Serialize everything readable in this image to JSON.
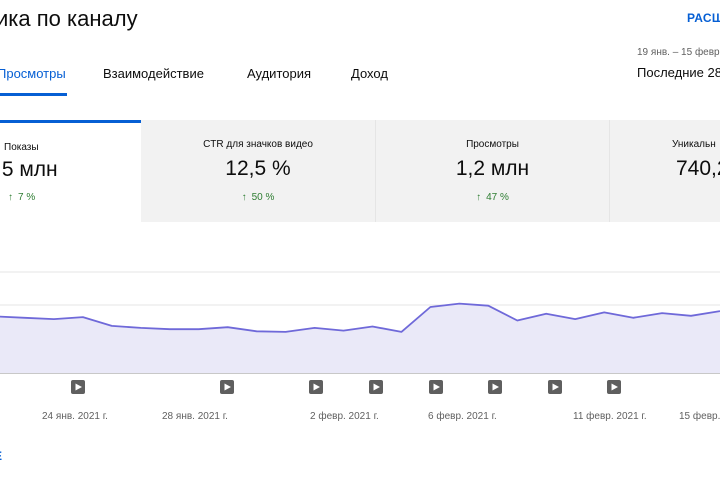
{
  "header": {
    "title": "ика по каналу",
    "advanced_link": "РАСШ"
  },
  "period": {
    "range": "19 янв. – 15 февр.",
    "label": "Последние 28"
  },
  "tabs": [
    {
      "label": "Просмотры",
      "active": true
    },
    {
      "label": "Взаимодействие",
      "active": false
    },
    {
      "label": "Аудитория",
      "active": false
    },
    {
      "label": "Доход",
      "active": false
    }
  ],
  "metrics": [
    {
      "label": "Показы",
      "value": ",5 млн",
      "change": "7 %",
      "trend": "up"
    },
    {
      "label": "CTR для значков видео",
      "value": "12,5 %",
      "change": "50 %",
      "trend": "up"
    },
    {
      "label": "Просмотры",
      "value": "1,2 млн",
      "change": "47 %",
      "trend": "up"
    },
    {
      "label": "Уникальн",
      "value": "740,2",
      "change": "",
      "trend": "up"
    }
  ],
  "colors": {
    "accent": "#065fd4",
    "line": "#6f69d9",
    "fill": "#eae9f8",
    "positive": "#2e7d32"
  },
  "chart_data": {
    "type": "area",
    "y": [
      84,
      82,
      80,
      83,
      70,
      67,
      65,
      65,
      68,
      62,
      61,
      67,
      63,
      69,
      61,
      98,
      103,
      100,
      78,
      88,
      80,
      90,
      82,
      89,
      85,
      92
    ],
    "ylim": [
      0,
      150
    ],
    "x_ticks": [
      "24 янв. 2021 г.",
      "28 янв. 2021 г.",
      "2 февр. 2021 г.",
      "6 февр. 2021 г.",
      "11 февр. 2021 г.",
      "15 февр."
    ],
    "video_markers": 10,
    "grid": true
  },
  "footer": {
    "more_link": "Е"
  }
}
